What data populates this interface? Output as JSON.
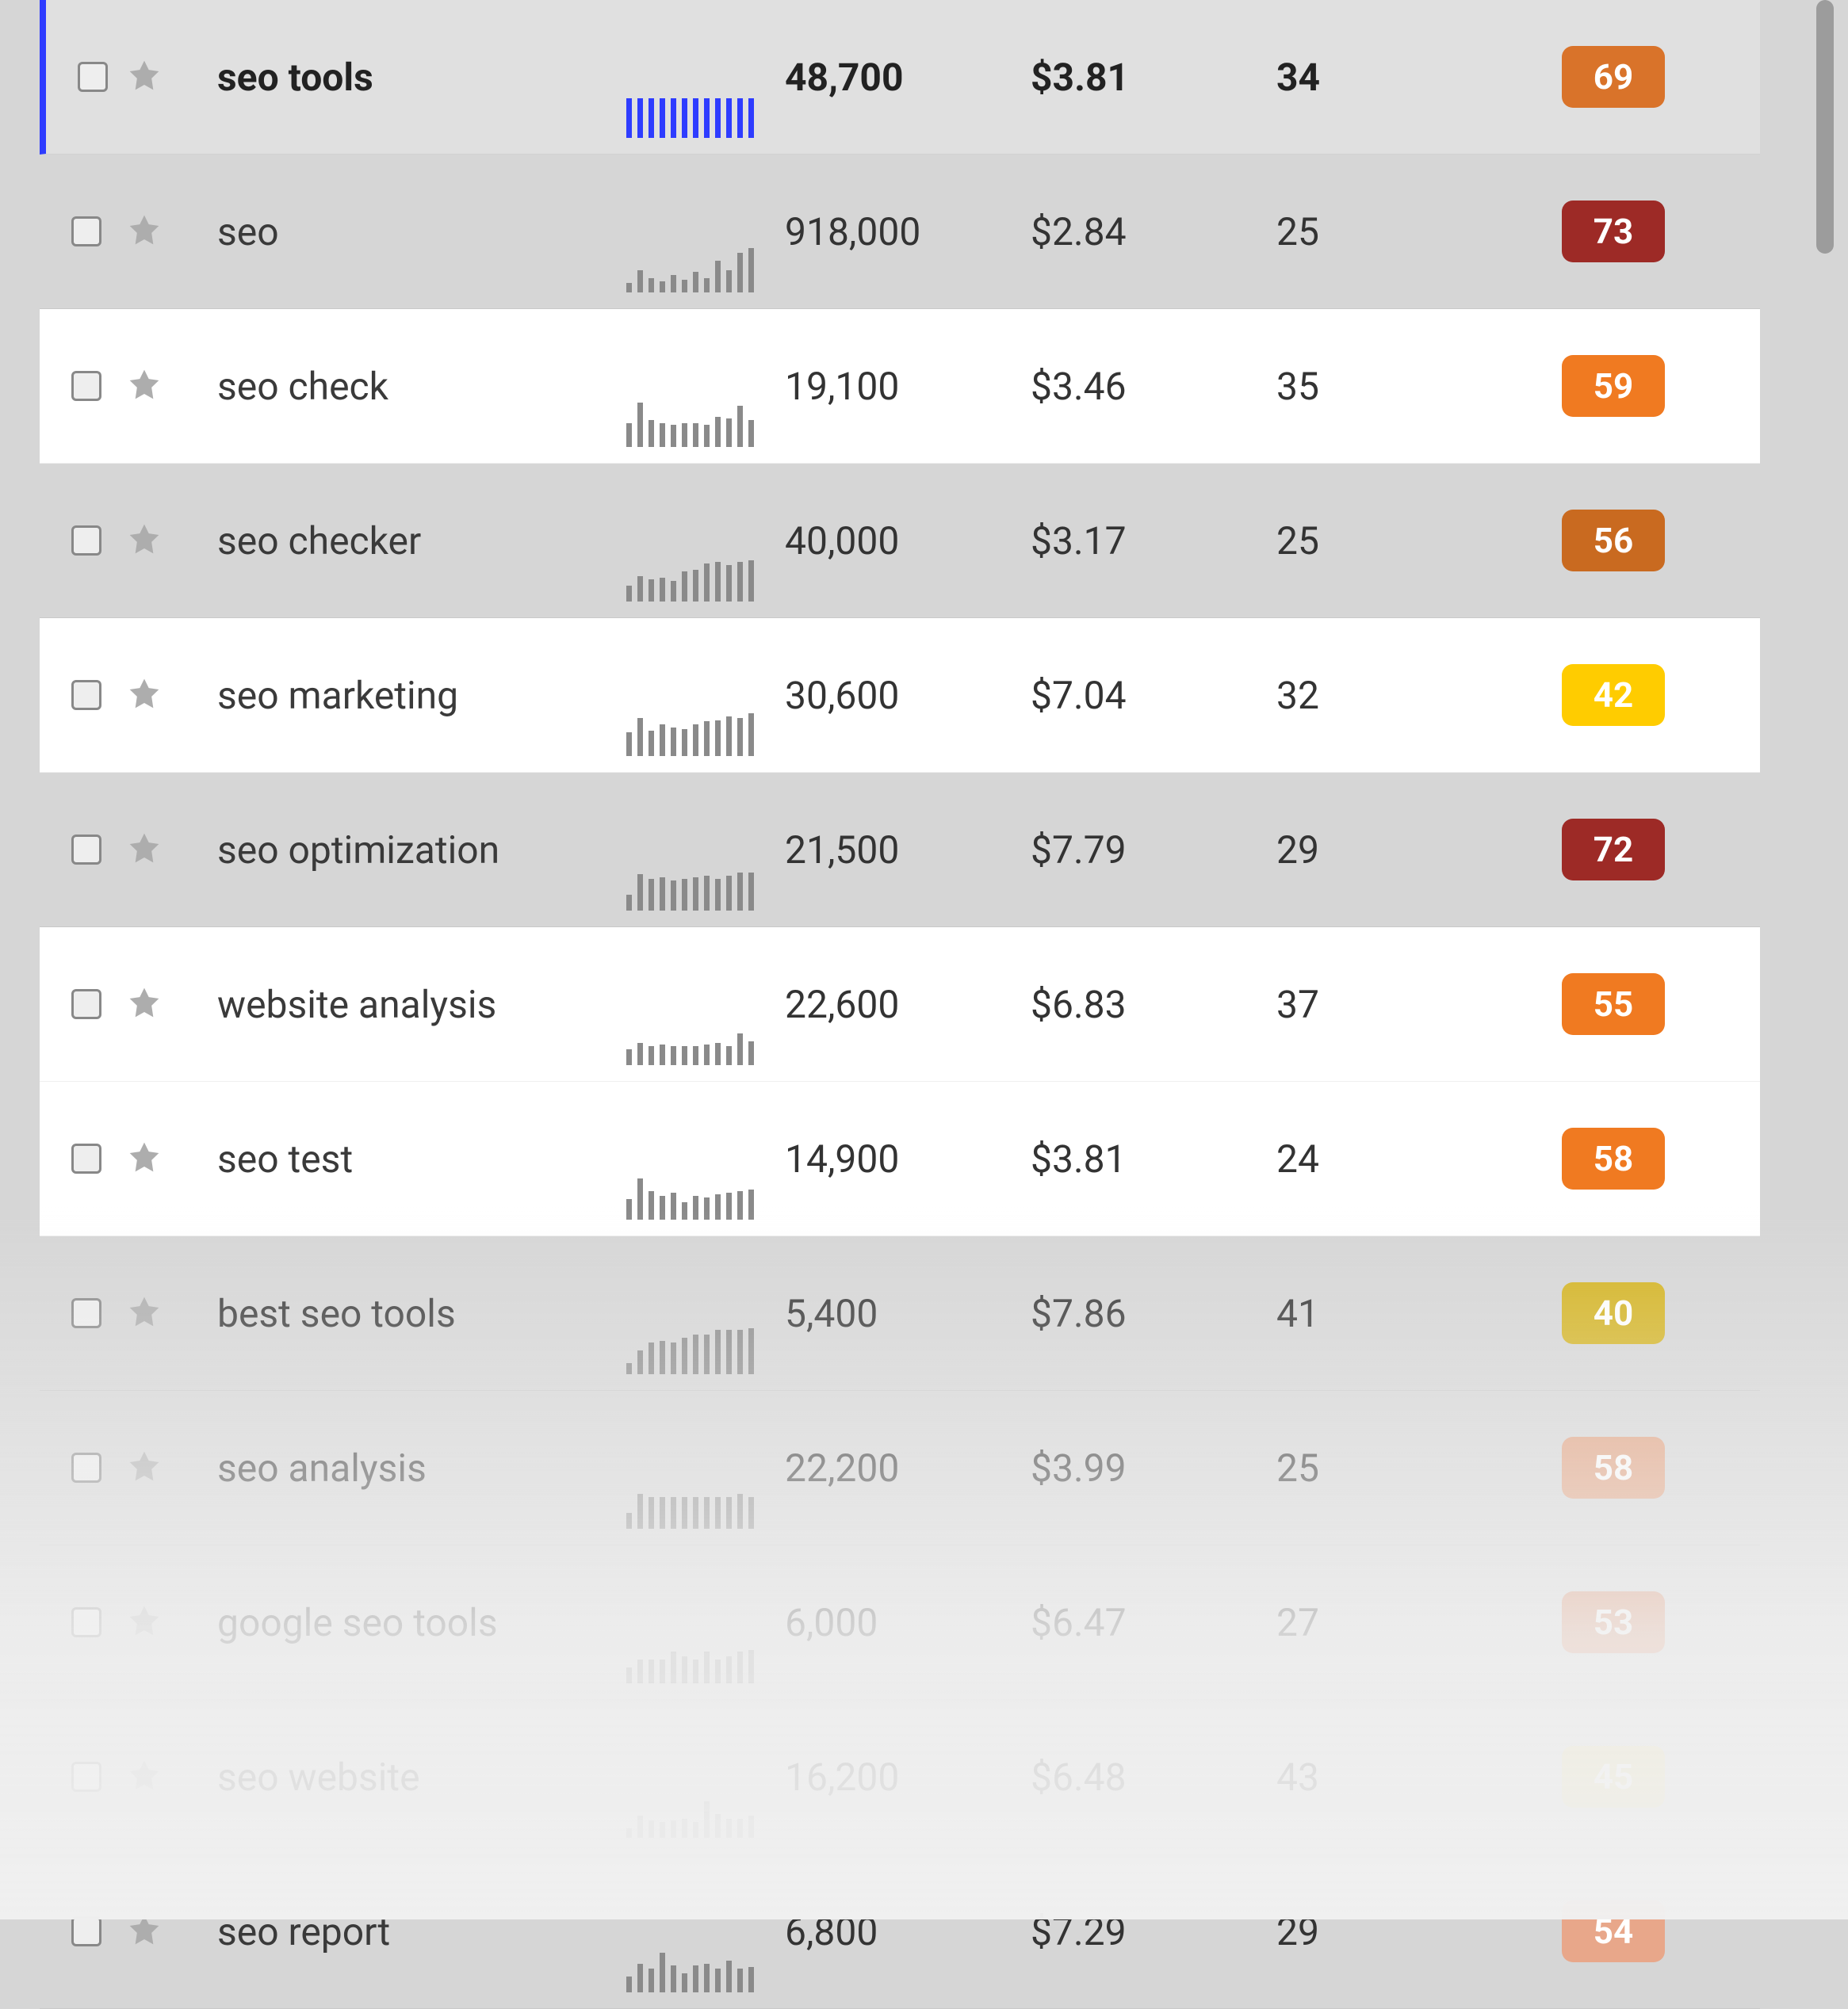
{
  "rows": [
    {
      "keyword": "seo tools",
      "volume": "48,700",
      "cpc": "$3.81",
      "comp": "34",
      "kd": "69",
      "kd_color": "#d9732a",
      "highlighted": false,
      "first": true,
      "spark": [
        50,
        50,
        50,
        50,
        50,
        50,
        50,
        50,
        50,
        50,
        50,
        50
      ]
    },
    {
      "keyword": "seo",
      "volume": "918,000",
      "cpc": "$2.84",
      "comp": "25",
      "kd": "73",
      "kd_color": "#9d2a26",
      "highlighted": false,
      "spark": [
        12,
        28,
        18,
        14,
        22,
        16,
        26,
        18,
        40,
        28,
        50,
        56
      ]
    },
    {
      "keyword": "seo check",
      "volume": "19,100",
      "cpc": "$3.46",
      "comp": "35",
      "kd": "59",
      "kd_color": "#f07a21",
      "highlighted": true,
      "spark": [
        30,
        56,
        34,
        30,
        28,
        30,
        30,
        28,
        38,
        36,
        52,
        34
      ]
    },
    {
      "keyword": "seo checker",
      "volume": "40,000",
      "cpc": "$3.17",
      "comp": "25",
      "kd": "56",
      "kd_color": "#c96a20",
      "highlighted": false,
      "spark": [
        20,
        32,
        28,
        30,
        26,
        38,
        40,
        48,
        50,
        46,
        50,
        52
      ]
    },
    {
      "keyword": "seo marketing",
      "volume": "30,600",
      "cpc": "$7.04",
      "comp": "32",
      "kd": "42",
      "kd_color": "#ffcc00",
      "highlighted": true,
      "spark": [
        30,
        48,
        32,
        40,
        36,
        34,
        40,
        44,
        45,
        50,
        48,
        54
      ]
    },
    {
      "keyword": "seo optimization",
      "volume": "21,500",
      "cpc": "$7.79",
      "comp": "29",
      "kd": "72",
      "kd_color": "#9d2a26",
      "highlighted": false,
      "spark": [
        20,
        46,
        40,
        42,
        38,
        40,
        42,
        44,
        40,
        44,
        48,
        48
      ]
    },
    {
      "keyword": "website analysis",
      "volume": "22,600",
      "cpc": "$6.83",
      "comp": "37",
      "kd": "55",
      "kd_color": "#f07a21",
      "highlighted": true,
      "spark": [
        20,
        28,
        24,
        26,
        24,
        24,
        24,
        26,
        28,
        24,
        40,
        30
      ]
    },
    {
      "keyword": "seo test",
      "volume": "14,900",
      "cpc": "$3.81",
      "comp": "24",
      "kd": "58",
      "kd_color": "#f07a21",
      "highlighted": true,
      "spark": [
        26,
        52,
        36,
        30,
        34,
        22,
        30,
        28,
        32,
        34,
        36,
        38
      ]
    },
    {
      "keyword": "best seo tools",
      "volume": "5,400",
      "cpc": "$7.86",
      "comp": "41",
      "kd": "40",
      "kd_color": "#d4b31e",
      "highlighted": false,
      "spark": [
        14,
        30,
        40,
        42,
        40,
        46,
        50,
        50,
        56,
        56,
        56,
        58
      ]
    },
    {
      "keyword": "seo analysis",
      "volume": "22,200",
      "cpc": "$3.99",
      "comp": "25",
      "kd": "58",
      "kd_color": "#e29d79",
      "highlighted": false,
      "spark": [
        20,
        44,
        40,
        40,
        40,
        40,
        40,
        40,
        40,
        40,
        44,
        40
      ]
    },
    {
      "keyword": "google seo tools",
      "volume": "6,000",
      "cpc": "$6.47",
      "comp": "27",
      "kd": "53",
      "kd_color": "#d8825a",
      "highlighted": false,
      "spark": [
        20,
        30,
        30,
        30,
        40,
        34,
        30,
        40,
        30,
        34,
        40,
        42
      ]
    },
    {
      "keyword": "seo website",
      "volume": "16,200",
      "cpc": "$6.48",
      "comp": "43",
      "kd": "45",
      "kd_color": "#e5d680",
      "highlighted": false,
      "spark": [
        12,
        28,
        22,
        20,
        22,
        24,
        20,
        46,
        30,
        24,
        24,
        28
      ]
    },
    {
      "keyword": "seo report",
      "volume": "6,800",
      "cpc": "$7.29",
      "comp": "29",
      "kd": "54",
      "kd_color": "#e8a78a",
      "highlighted": false,
      "spark": [
        20,
        36,
        30,
        50,
        34,
        24,
        34,
        36,
        30,
        40,
        30,
        32
      ]
    }
  ]
}
